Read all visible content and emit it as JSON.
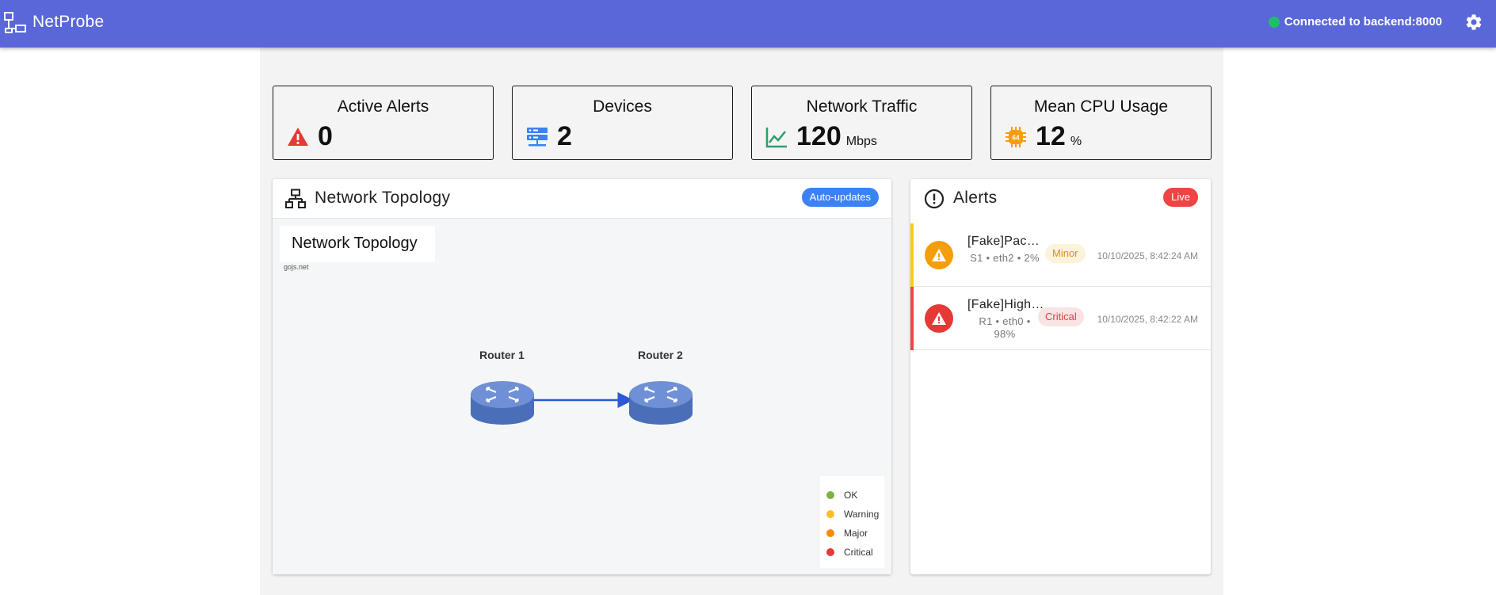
{
  "app": {
    "title": "NetProbe",
    "connection_status": "Connected to backend:8000"
  },
  "stats": [
    {
      "label": "Active Alerts",
      "value": "0",
      "unit": "",
      "icon": "warning-triangle-icon",
      "color": "#e53935"
    },
    {
      "label": "Devices",
      "value": "2",
      "unit": "",
      "icon": "server-icon",
      "color": "#3b82f6"
    },
    {
      "label": "Network Traffic",
      "value": "120",
      "unit": "Mbps",
      "icon": "line-chart-icon",
      "color": "#2e9e6a"
    },
    {
      "label": "Mean CPU Usage",
      "value": "12",
      "unit": "%",
      "icon": "cpu-chip-icon",
      "color": "#f59e0b"
    }
  ],
  "topology": {
    "panel_title": "Network Topology",
    "badge": "Auto-updates",
    "canvas_title": "Network Topology",
    "credit": "gojs.net",
    "nodes": [
      {
        "label": "Router 1"
      },
      {
        "label": "Router 2"
      }
    ],
    "legend": [
      {
        "label": "OK",
        "color": "#7cb342"
      },
      {
        "label": "Warning",
        "color": "#fbbf24"
      },
      {
        "label": "Major",
        "color": "#fb8c00"
      },
      {
        "label": "Critical",
        "color": "#e53935"
      }
    ]
  },
  "alerts": {
    "panel_title": "Alerts",
    "badge": "Live",
    "items": [
      {
        "title": "[Fake]Packet Loss",
        "meta": "S1 • eth2 • 2%",
        "severity": "Minor",
        "time": "10/10/2025, 8:42:24 AM",
        "color": "#f59e0b",
        "bar_color": "#facc15",
        "chip_bg": "#fdf3dc",
        "chip_fg": "#d4931a"
      },
      {
        "title": "[Fake]High CPU",
        "meta": "R1 • eth0 • 98%",
        "severity": "Critical",
        "time": "10/10/2025, 8:42:22 AM",
        "color": "#e53935",
        "bar_color": "#ef4444",
        "chip_bg": "#fbe3e3",
        "chip_fg": "#d04545"
      }
    ]
  }
}
